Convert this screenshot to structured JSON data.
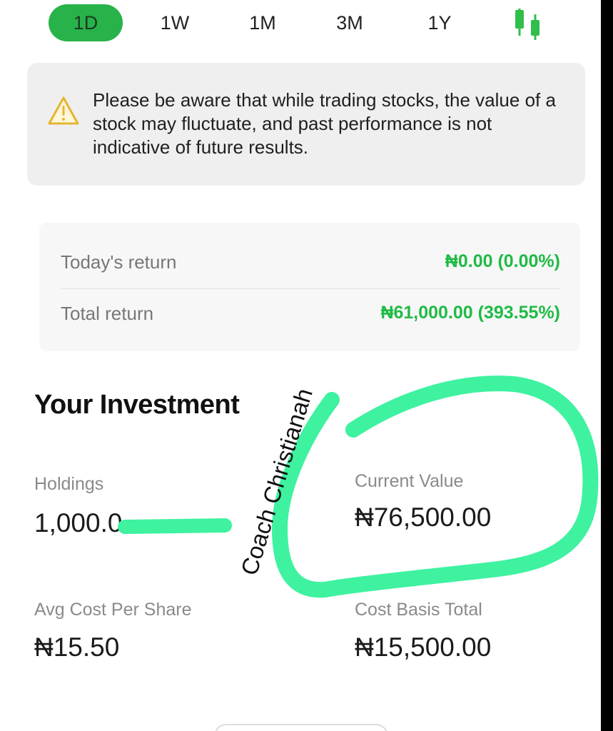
{
  "tabs": {
    "items": [
      {
        "label": "1D",
        "active": true
      },
      {
        "label": "1W",
        "active": false
      },
      {
        "label": "1M",
        "active": false
      },
      {
        "label": "3M",
        "active": false
      },
      {
        "label": "1Y",
        "active": false
      }
    ],
    "chart_toggle_icon": "candlestick-icon"
  },
  "warning": {
    "icon": "warning-triangle-icon",
    "text": "Please be aware that while trading stocks, the value of a stock may fluctuate, and past performance is not indicative of future results."
  },
  "returns": {
    "todays_label": "Today's return",
    "todays_value": "₦0.00 (0.00%)",
    "total_label": "Total return",
    "total_value": "₦61,000.00 (393.55%)"
  },
  "investment": {
    "title": "Your Investment",
    "holdings_label": "Holdings",
    "holdings_value": "1,000.0",
    "current_value_label": "Current Value",
    "current_value": "₦76,500.00",
    "avg_cost_label": "Avg Cost Per Share",
    "avg_cost_value": "₦15.50",
    "cost_basis_label": "Cost Basis Total",
    "cost_basis_value": "₦15,500.00"
  },
  "annotation": {
    "watermark": "Coach Christianah"
  },
  "colors": {
    "accent_green": "#27b24a",
    "return_green": "#1fbb45",
    "highlight": "#3ef2a0"
  }
}
